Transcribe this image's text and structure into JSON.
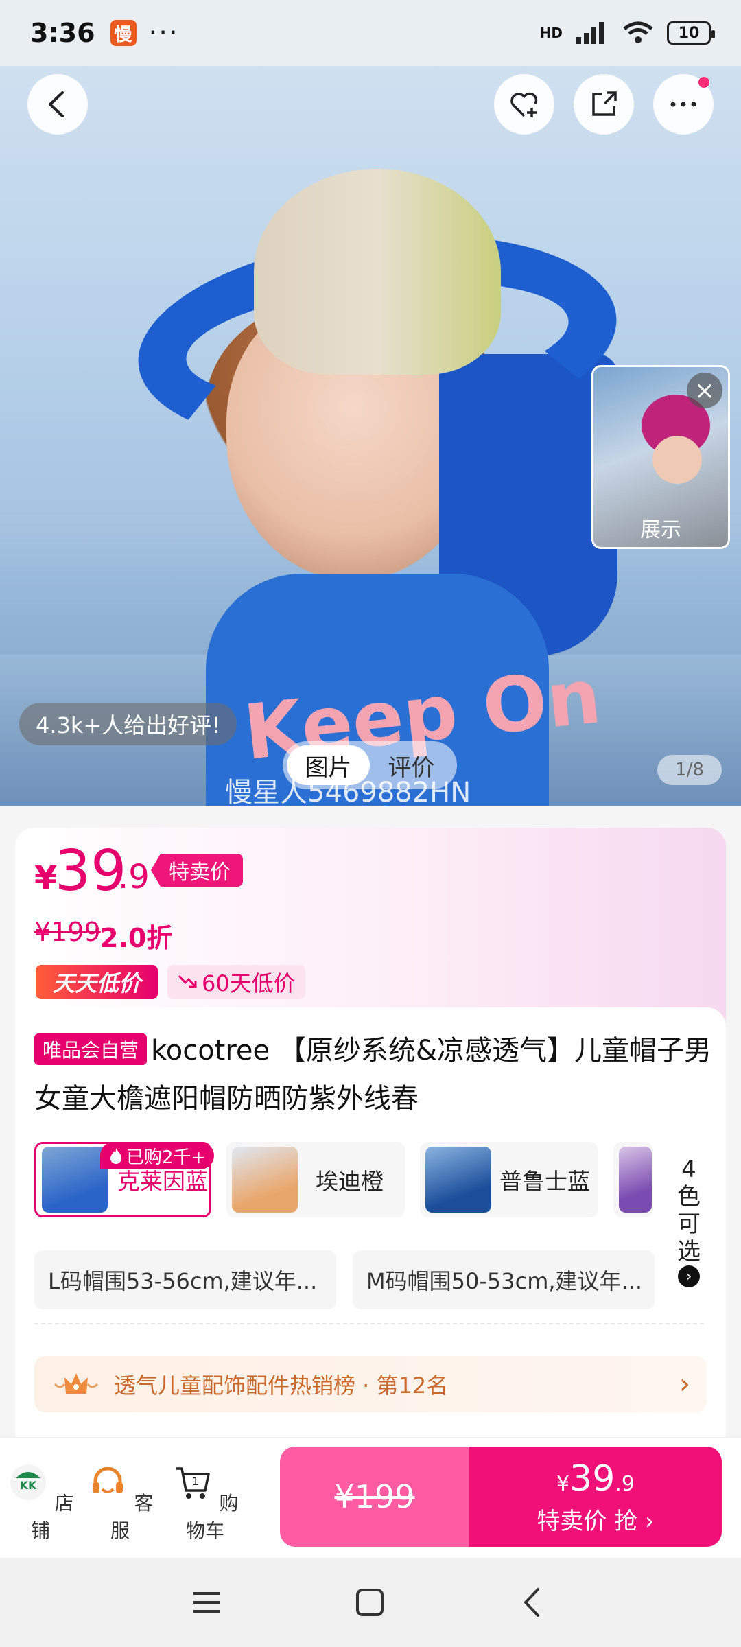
{
  "status_bar": {
    "time": "3:36",
    "app_badge": "慢",
    "dots": "···",
    "network": "HD",
    "battery": "10"
  },
  "hero": {
    "review_summary": "4.3k+人给出好评!",
    "tabs": [
      "图片",
      "评价"
    ],
    "active_tab": "图片",
    "page_indicator": "1/8",
    "watermark": "慢星人5469882HN",
    "floating_thumb_label": "展示",
    "shirt_print": "Keep On"
  },
  "price": {
    "currency": "¥",
    "integer": "39",
    "decimal": ".9",
    "sale_tag": "特卖价",
    "original": "¥199",
    "discount": "2.0折",
    "daily_low_badge": "天天低价",
    "days_low": "60天低价"
  },
  "product": {
    "vip_badge": "唯品会自营",
    "title": "kocotree 【原纱系统&凉感透气】儿童帽子男女童大檐遮阳帽防晒防紫外线春"
  },
  "variants": {
    "bought_badge": "已购2千+",
    "items": [
      {
        "label": "克莱因蓝",
        "selected": true
      },
      {
        "label": "埃迪橙",
        "selected": false
      },
      {
        "label": "普鲁士蓝",
        "selected": false
      }
    ],
    "more_label": "4色可选"
  },
  "sizes": [
    "L码帽围53-56cm,建议年...",
    "M码帽围50-53cm,建议年..."
  ],
  "ranking": {
    "text": "透气儿童配饰配件热销榜 · 第12名"
  },
  "bottom_bar": {
    "store": "店铺",
    "service": "客服",
    "cart": "购物车",
    "cart_count": "1",
    "buy_left_price": "¥199",
    "buy_right_currency": "¥",
    "buy_right_price": "39",
    "buy_right_decimal": ".9",
    "buy_right_label": "特卖价 抢 ›"
  },
  "colors": {
    "accent": "#e5006d",
    "buy_left": "#ff5ba2",
    "buy_right": "#f10f78"
  }
}
